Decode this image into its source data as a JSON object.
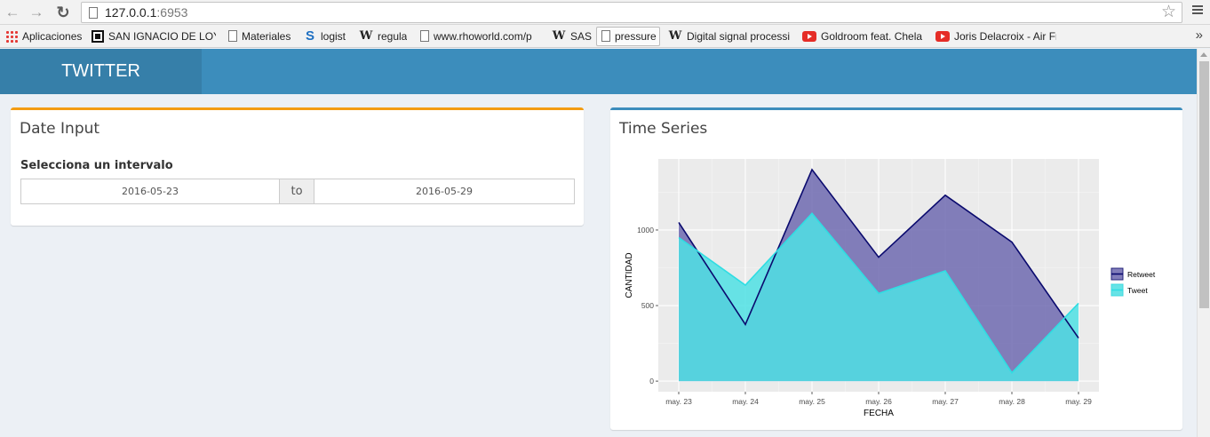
{
  "browser": {
    "url_host": "127.0.0.1",
    "url_port": ":6953",
    "bookmarks": [
      {
        "label": "Aplicaciones",
        "icon": "apps-grid-icon"
      },
      {
        "label": "SAN IGNACIO DE LOY",
        "icon": "square-logo-icon"
      },
      {
        "label": "Materiales",
        "icon": "page-icon"
      },
      {
        "label": "logist",
        "icon": "s-logo-icon"
      },
      {
        "label": "regula",
        "icon": "wikipedia-icon"
      },
      {
        "label": "www.rhoworld.com/p",
        "icon": "page-icon"
      },
      {
        "label": "SAS",
        "icon": "wikipedia-icon"
      },
      {
        "label": "pressure",
        "icon": "page-icon"
      },
      {
        "label": "Digital signal processi",
        "icon": "wikipedia-icon"
      },
      {
        "label": "Goldroom feat. Chela",
        "icon": "youtube-icon"
      },
      {
        "label": "Joris Delacroix - Air Fr",
        "icon": "youtube-icon"
      }
    ],
    "more_glyph": "»"
  },
  "app": {
    "title": "TWITTER",
    "header_color": "#3c8dbc",
    "logo_color": "#367fa9"
  },
  "date_box": {
    "title": "Date Input",
    "label": "Selecciona un intervalo",
    "start": "2016-05-23",
    "separator": "to",
    "end": "2016-05-29",
    "accent": "#f39c12"
  },
  "chart_box": {
    "title": "Time Series",
    "accent": "#3c8dbc"
  },
  "chart_data": {
    "type": "area",
    "title": "",
    "xlabel": "FECHA",
    "ylabel": "CANTIDAD",
    "categories": [
      "may. 23",
      "may. 24",
      "may. 25",
      "may. 26",
      "may. 27",
      "may. 28",
      "may. 29"
    ],
    "yticks": [
      0,
      500,
      1000
    ],
    "ylim": [
      -70,
      1470
    ],
    "grid": true,
    "legend_position": "right",
    "series": [
      {
        "name": "Retweet",
        "values": [
          1050,
          375,
          1400,
          820,
          1230,
          920,
          285
        ],
        "fill": "#6f6ab0",
        "stroke": "#0a0a6e"
      },
      {
        "name": "Tweet",
        "values": [
          950,
          635,
          1110,
          580,
          730,
          55,
          515
        ],
        "fill": "#4fe1e4",
        "stroke": "#2fdde3"
      }
    ]
  }
}
